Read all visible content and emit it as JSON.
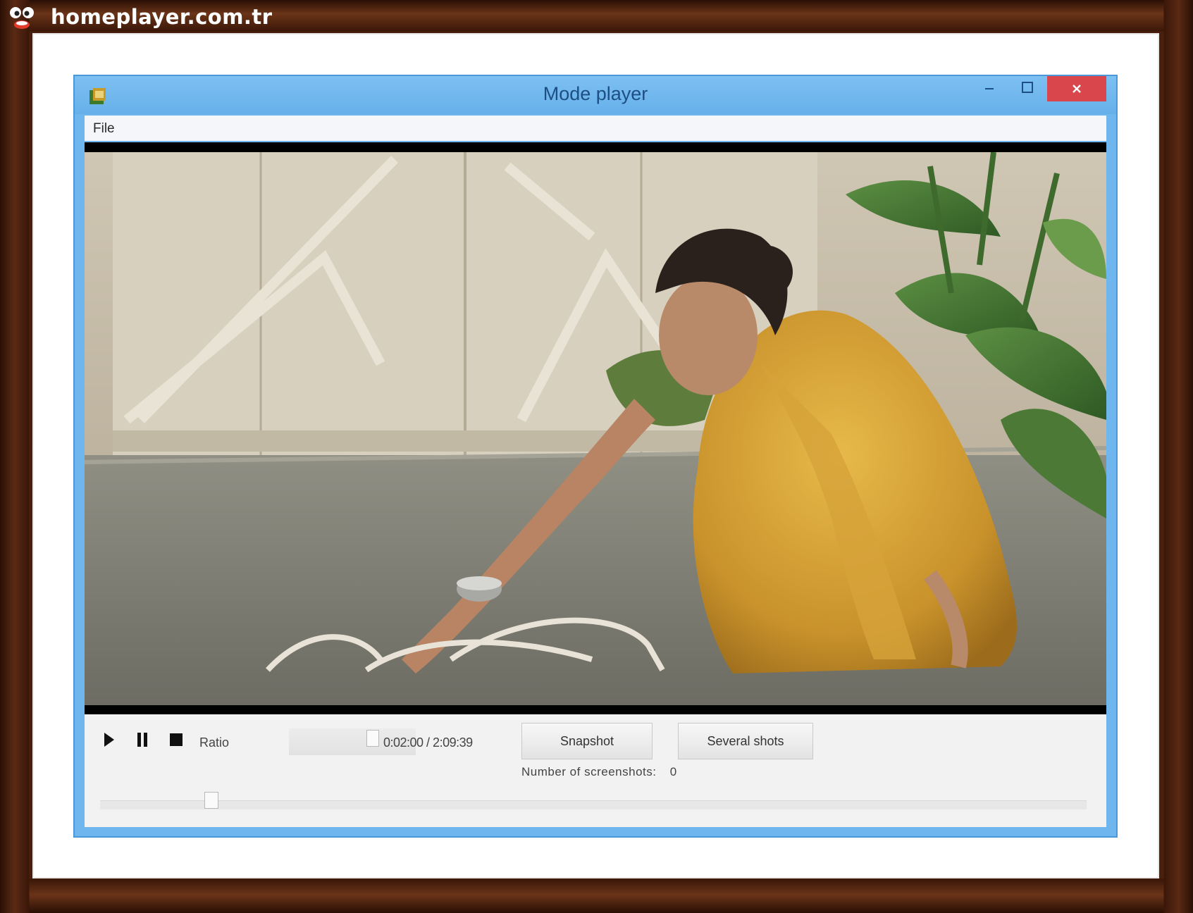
{
  "site": {
    "name": "homeplayer.com.tr"
  },
  "window": {
    "title": "Mode player"
  },
  "menu": {
    "file": "File"
  },
  "controls": {
    "ratio_label": "Ratio",
    "time": "0:02:00 / 2:09:39",
    "snapshot_label": "Snapshot",
    "several_shots_label": "Several shots",
    "shots_label": "Number of screenshots:",
    "shots_count": "0"
  },
  "icons": {
    "play": "play-icon",
    "pause": "pause-icon",
    "stop": "stop-icon",
    "minimize": "minimize-icon",
    "maximize": "maximize-icon",
    "close": "close-icon"
  },
  "colors": {
    "titlebar": "#6fb6ee",
    "close": "#d9474c",
    "frame": "#4a200d"
  }
}
